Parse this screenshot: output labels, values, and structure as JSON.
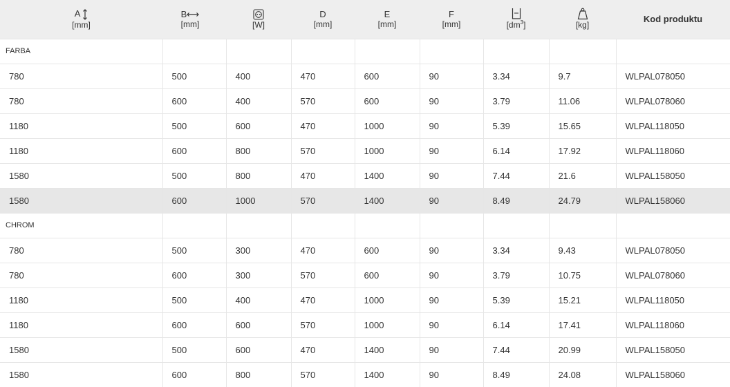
{
  "headers": {
    "a": {
      "name": "A",
      "unit": "[mm]",
      "icon": "vertical-arrows-icon"
    },
    "b": {
      "name": "B",
      "unit": "[mm]",
      "icon": "horizontal-arrows-icon"
    },
    "power": {
      "unit": "[W]",
      "icon": "socket-icon"
    },
    "d": {
      "name": "D",
      "unit": "[mm]"
    },
    "e": {
      "name": "E",
      "unit": "[mm]"
    },
    "f": {
      "name": "F",
      "unit": "[mm]"
    },
    "volume": {
      "unit": "[dm",
      "unit_sup": "3",
      "unit_end": "]",
      "icon": "container-icon"
    },
    "weight": {
      "unit": "[kg]",
      "icon": "weight-icon"
    },
    "code": {
      "name": "Kod produktu"
    }
  },
  "sections": [
    {
      "label": "FARBA",
      "rows": [
        [
          "780",
          "500",
          "400",
          "470",
          "600",
          "90",
          "3.34",
          "9.7",
          "WLPAL078050"
        ],
        [
          "780",
          "600",
          "400",
          "570",
          "600",
          "90",
          "3.79",
          "11.06",
          "WLPAL078060"
        ],
        [
          "1180",
          "500",
          "600",
          "470",
          "1000",
          "90",
          "5.39",
          "15.65",
          "WLPAL118050"
        ],
        [
          "1180",
          "600",
          "800",
          "570",
          "1000",
          "90",
          "6.14",
          "17.92",
          "WLPAL118060"
        ],
        [
          "1580",
          "500",
          "800",
          "470",
          "1400",
          "90",
          "7.44",
          "21.6",
          "WLPAL158050"
        ],
        [
          "1580",
          "600",
          "1000",
          "570",
          "1400",
          "90",
          "8.49",
          "24.79",
          "WLPAL158060"
        ]
      ]
    },
    {
      "label": "CHROM",
      "rows": [
        [
          "780",
          "500",
          "300",
          "470",
          "600",
          "90",
          "3.34",
          "9.43",
          "WLPAL078050"
        ],
        [
          "780",
          "600",
          "300",
          "570",
          "600",
          "90",
          "3.79",
          "10.75",
          "WLPAL078060"
        ],
        [
          "1180",
          "500",
          "400",
          "470",
          "1000",
          "90",
          "5.39",
          "15.21",
          "WLPAL118050"
        ],
        [
          "1180",
          "600",
          "600",
          "570",
          "1000",
          "90",
          "6.14",
          "17.41",
          "WLPAL118060"
        ],
        [
          "1580",
          "500",
          "600",
          "470",
          "1400",
          "90",
          "7.44",
          "20.99",
          "WLPAL158050"
        ],
        [
          "1580",
          "600",
          "800",
          "570",
          "1400",
          "90",
          "8.49",
          "24.08",
          "WLPAL158060"
        ]
      ]
    }
  ],
  "highlighted_row": {
    "section": 0,
    "row": 5
  },
  "colors": {
    "header_bg": "#eeeeee",
    "highlight_bg": "#e7e7e7",
    "grid": "#e6e6e6",
    "text": "#333333"
  }
}
